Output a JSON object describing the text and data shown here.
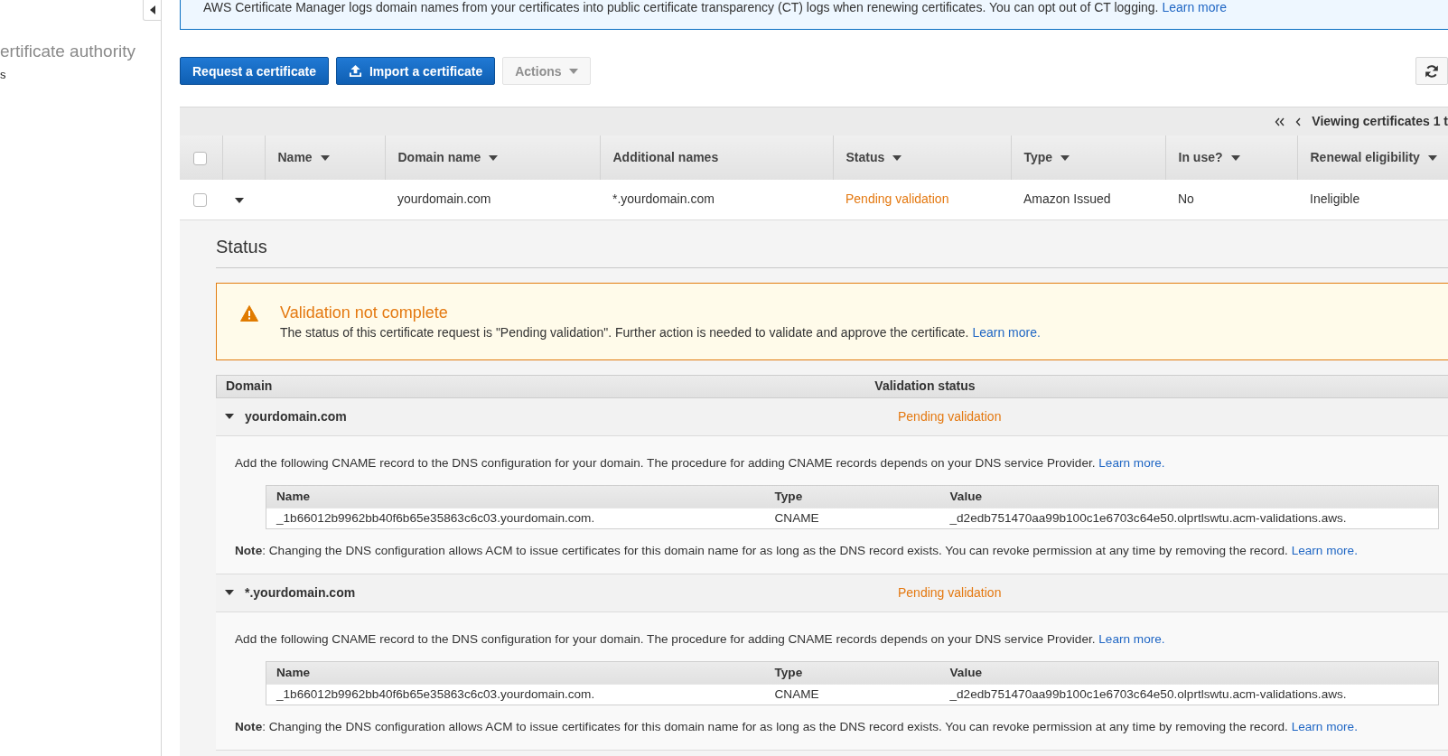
{
  "sidebar": {
    "title": "ertificate authority",
    "links": [
      "s"
    ]
  },
  "banner": {
    "text": "AWS Certificate Manager logs domain names from your certificates into public certificate transparency (CT) logs when renewing certificates. You can opt out of CT logging.",
    "link": "Learn more"
  },
  "actions": [
    {
      "label": "Request a certificate",
      "kind": "primary",
      "disabled": false
    },
    {
      "label": "Import a certificate",
      "kind": "upload",
      "disabled": false
    },
    {
      "label": "Actions",
      "kind": "dropdown",
      "disabled": true
    }
  ],
  "certificates": {
    "pagination": "Viewing certificates 1 t",
    "select_all": false,
    "columns": [
      {
        "label": "Name",
        "sortable": true
      },
      {
        "label": "Domain name",
        "sortable": true
      },
      {
        "label": "Additional names",
        "sortable": false
      },
      {
        "label": "Status",
        "sortable": true
      },
      {
        "label": "Type",
        "sortable": true
      },
      {
        "label": "In use?",
        "sortable": true
      },
      {
        "label": "Renewal eligibility",
        "sortable": true
      }
    ],
    "rows": [
      {
        "checked": false,
        "expanded": true,
        "domain_name": "yourdomain.com",
        "additional_names": "*.yourdomain.com",
        "status": {
          "text": "Pending validation",
          "kind": "pending"
        },
        "type": "Amazon Issued",
        "in_use": "No",
        "renewal_eligibility": "Ineligible",
        "detail": {
          "heading": "Status",
          "alert": {
            "kind": "warning",
            "title": "Validation not complete",
            "text": "The status of this certificate request is \"Pending validation\". Further action is needed to validate and approve the certificate.",
            "link": "Learn more."
          },
          "domains": {
            "columns": [
              "Domain",
              "Validation status"
            ],
            "rows": [
              {
                "domain": "yourdomain.com",
                "expanded": true,
                "status": {
                  "text": "Pending validation",
                  "kind": "pending"
                },
                "instructions": "Add the following CNAME record to the DNS configuration for your domain. The procedure for adding CNAME records depends on your DNS service Provider.",
                "instructions_link": "Learn more.",
                "record": {
                  "columns": [
                    "Name",
                    "Type",
                    "Value"
                  ],
                  "values": [
                    "_1b66012b9962bb40f6b65e35863c6c03.yourdomain.com.",
                    "CNAME",
                    "_d2edb751470aa99b100c1e6703c64e50.olprtlswtu.acm-validations.aws."
                  ]
                },
                "note": "**Note**: Changing the DNS configuration allows ACM to issue certificates for this domain name for as long as the DNS record exists. You can revoke permission at any time by removing the record.",
                "note_link": "Learn more."
              },
              {
                "domain": "*.yourdomain.com",
                "expanded": true,
                "status": {
                  "text": "Pending validation",
                  "kind": "pending"
                },
                "instructions": "Add the following CNAME record to the DNS configuration for your domain. The procedure for adding CNAME records depends on your DNS service Provider.",
                "instructions_link": "Learn more.",
                "record": {
                  "columns": [
                    "Name",
                    "Type",
                    "Value"
                  ],
                  "values": [
                    "_1b66012b9962bb40f6b65e35863c6c03.yourdomain.com.",
                    "CNAME",
                    "_d2edb751470aa99b100c1e6703c64e50.olprtlswtu.acm-validations.aws."
                  ]
                },
                "note": "**Note**: Changing the DNS configuration allows ACM to issue certificates for this domain name for as long as the DNS record exists. You can revoke permission at any time by removing the record.",
                "note_link": "Learn more."
              }
            ]
          }
        }
      }
    ]
  }
}
